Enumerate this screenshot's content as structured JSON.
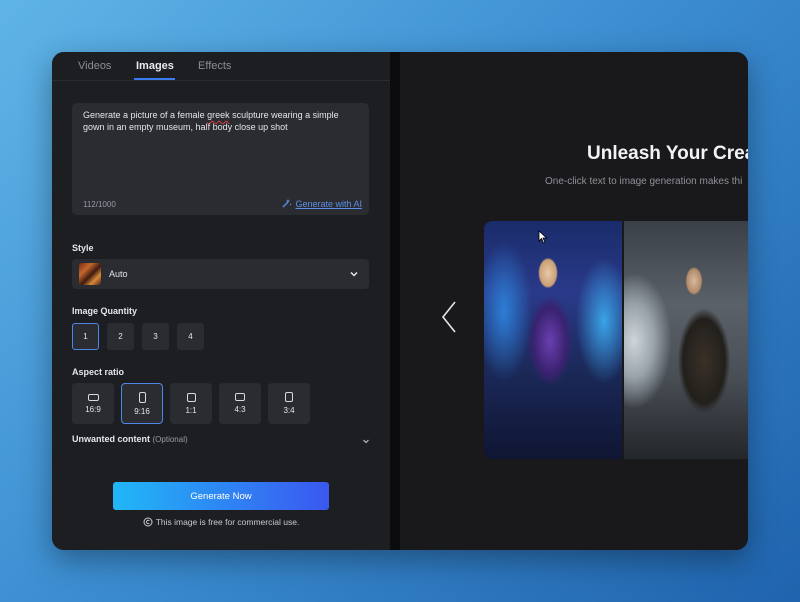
{
  "tabs": [
    {
      "label": "Videos",
      "active": false
    },
    {
      "label": "Images",
      "active": true
    },
    {
      "label": "Effects",
      "active": false
    }
  ],
  "prompt": {
    "text_before": "Generate a picture of a female ",
    "text_underlined": "greek",
    "text_after": " sculpture wearing a simple gown in an empty museum, half body close up shot",
    "counter": "112/1000",
    "generate_ai_label": "Generate with AI"
  },
  "style": {
    "label": "Style",
    "value": "Auto"
  },
  "quantity": {
    "label": "Image Quantity",
    "options": [
      "1",
      "2",
      "3",
      "4"
    ],
    "selected": "1"
  },
  "aspect": {
    "label": "Aspect ratio",
    "options": [
      "16:9",
      "9:16",
      "1:1",
      "4:3",
      "3:4"
    ],
    "selected": "9:16"
  },
  "unwanted": {
    "label": "Unwanted content",
    "optional": "(Optional)"
  },
  "generate_button": "Generate Now",
  "free_note": "This image is free for commercial use.",
  "hero": {
    "headline": "Unleash Your Crea",
    "subline": "One-click text to image generation makes thi"
  },
  "colors": {
    "accent": "#3a7bf0",
    "button_start": "#21b7f7",
    "button_end": "#3b57f0",
    "panel": "#1d1e22",
    "field": "#2b2c31"
  }
}
